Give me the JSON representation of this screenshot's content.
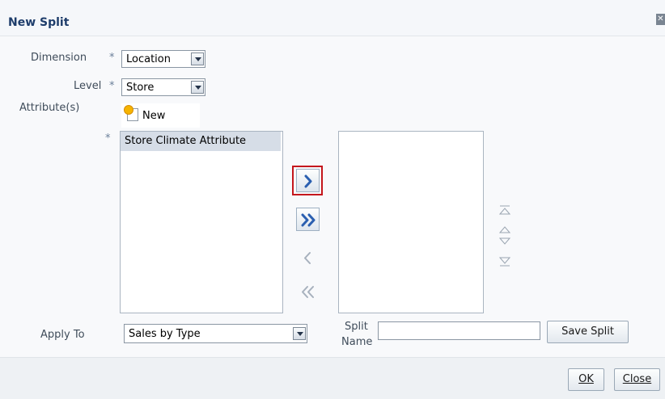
{
  "dialog": {
    "title": "New Split"
  },
  "form": {
    "dimension_label": "Dimension",
    "dimension_value": "Location",
    "level_label": "Level",
    "level_value": "Store",
    "attributes_label": "Attribute(s)",
    "required_mark": "*",
    "new_button_label": "New",
    "available_attributes": [
      "Store Climate Attribute"
    ],
    "selected_attributes": [],
    "apply_to_label": "Apply To",
    "apply_to_value": "Sales by Type",
    "split_name_label_line1": "Split",
    "split_name_label_line2": "Name",
    "split_name_value": "",
    "save_split_label": "Save Split"
  },
  "shuttle": {
    "move": "move-right",
    "move_all": "move-all-right",
    "remove": "move-left",
    "remove_all": "move-all-left"
  },
  "footer": {
    "ok_label": "OK",
    "close_label": "Close"
  },
  "colors": {
    "title": "#1e3d6b",
    "highlight": "#c4161c",
    "arrow_enabled": "#2a5fb0",
    "arrow_disabled": "#a7b1bd"
  }
}
